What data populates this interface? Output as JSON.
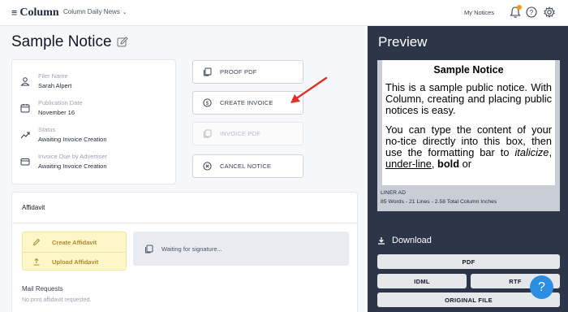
{
  "header": {
    "logo_text": "Column",
    "logo_mark": "≡",
    "paper_name": "Column Daily News",
    "my_notices": "My Notices",
    "bell_badge_color": "#f59e0b"
  },
  "notice": {
    "title": "Sample Notice",
    "details": [
      {
        "icon": "user-icon",
        "label": "Filer Name",
        "value": "Sarah Alpert"
      },
      {
        "icon": "calendar-icon",
        "label": "Publication Date",
        "value": "November 16"
      },
      {
        "icon": "trend-icon",
        "label": "Status",
        "value": "Awaiting Invoice Creation"
      },
      {
        "icon": "card-icon",
        "label": "Invoice Due by Advertiser",
        "value": "Awaiting Invoice Creation"
      }
    ]
  },
  "actions": {
    "proof_pdf": "PROOF PDF",
    "create_invoice": "CREATE INVOICE",
    "invoice_pdf": "INVOICE PDF",
    "cancel_notice": "CANCEL NOTICE"
  },
  "affidavit": {
    "title": "Affidavit",
    "create": "Create Affidavit",
    "upload": "Upload Affidavit",
    "waiting": "Waiting for signature...",
    "mail_title": "Mail Requests",
    "mail_sub": "No print affidavit requested."
  },
  "preview": {
    "title": "Preview",
    "paper_heading": "Sample Notice",
    "para1": "This is a sample public notice. With Column, creating and placing public notices is easy.",
    "para2_a": "You can type the content of your no-tice directly into this box, then use the formatting bar to ",
    "para2_italic": "italicize",
    "para2_b": ", ",
    "para2_underline": "under-line",
    "para2_c": ", ",
    "para2_bold": "bold",
    "para2_d": " or",
    "ad_type": "LINER AD",
    "stats": "85 Words - 21 Lines - 2.58 Total Column Inches",
    "download": "Download",
    "pdf": "PDF",
    "idml": "IDML",
    "rtf": "RTF",
    "original": "ORIGINAL FILE"
  },
  "colors": {
    "accent_red": "#e0302a",
    "fab_blue": "#2b8ee0",
    "panel_dark": "#2c3648",
    "yellow_bg": "#fdf6c9"
  }
}
